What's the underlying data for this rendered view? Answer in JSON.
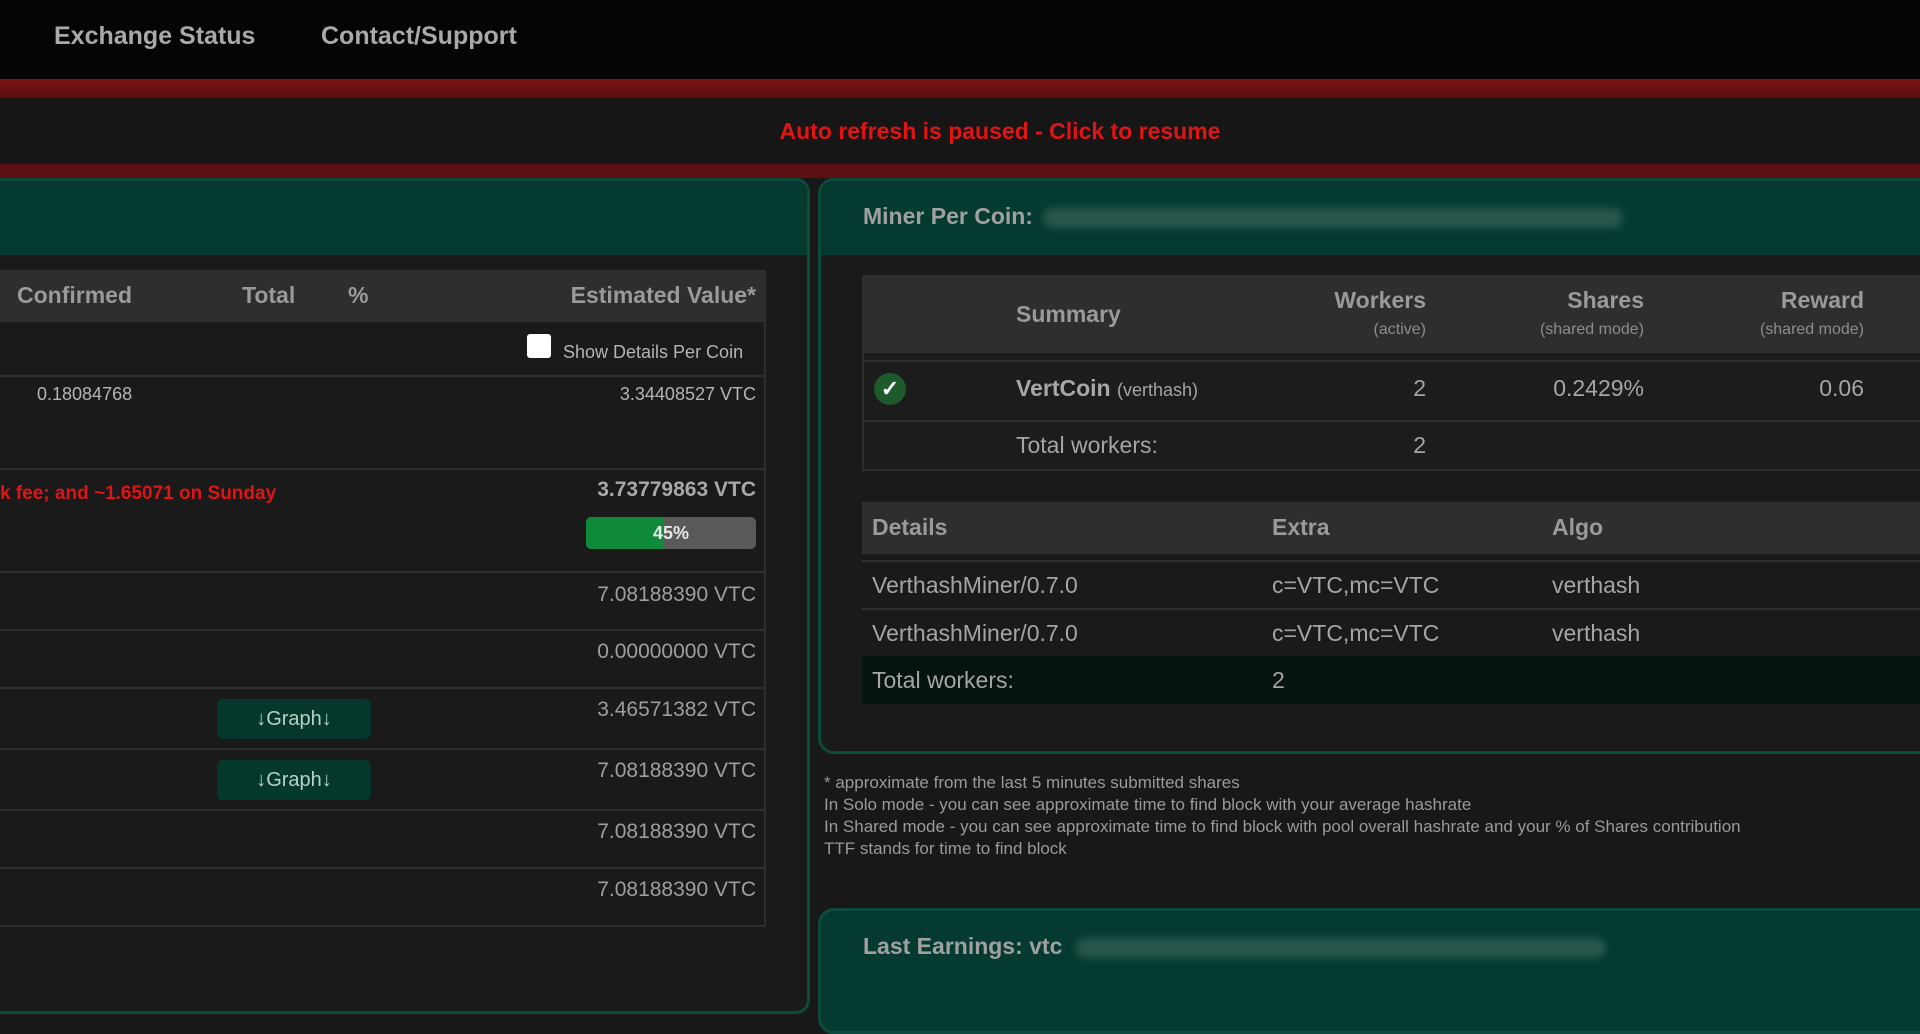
{
  "nav": {
    "items": [
      "Exchange Status",
      "Contact/Support"
    ]
  },
  "refresh": {
    "text": "Auto refresh is paused - Click to resume"
  },
  "balances": {
    "headers": {
      "confirmed": "Confirmed",
      "total": "Total",
      "percent": "%",
      "estimated": "Estimated Value*"
    },
    "show_details_label": "Show Details Per Coin",
    "coin_row": {
      "confirmed": "0.18084768",
      "estimated": "3.34408527 VTC"
    },
    "payout_fee_text": "k fee; and ~1.65071 on Sunday",
    "payout_value": "3.73779863 VTC",
    "progress": {
      "value": 45,
      "label": "45%"
    },
    "rows": [
      {
        "value": "7.08188390 VTC"
      },
      {
        "value": "0.00000000 VTC"
      },
      {
        "value": "3.46571382 VTC",
        "graph": "↓Graph↓"
      },
      {
        "value": "7.08188390 VTC",
        "graph": "↓Graph↓"
      },
      {
        "value": "7.08188390 VTC"
      },
      {
        "value": "7.08188390 VTC"
      }
    ]
  },
  "miner": {
    "title": "Miner Per Coin:",
    "summary": {
      "headers": {
        "summary": "Summary",
        "workers": "Workers",
        "workers_sub": "(active)",
        "shares": "Shares",
        "shares_sub": "(shared mode)",
        "reward": "Reward",
        "reward_sub": "(shared mode)"
      },
      "coin": {
        "name": "VertCoin",
        "algo": "(verthash)",
        "workers": "2",
        "shares": "0.2429%",
        "reward": "0.06"
      },
      "total": {
        "label": "Total workers:",
        "value": "2"
      }
    },
    "details": {
      "headers": {
        "details": "Details",
        "extra": "Extra",
        "algo": "Algo"
      },
      "rows": [
        {
          "details": "VerthashMiner/0.7.0",
          "extra": "c=VTC,mc=VTC",
          "algo": "verthash"
        },
        {
          "details": "VerthashMiner/0.7.0",
          "extra": "c=VTC,mc=VTC",
          "algo": "verthash"
        }
      ],
      "total": {
        "label": "Total workers:",
        "value": "2"
      }
    },
    "notes": [
      "* approximate from the last 5 minutes submitted shares",
      " In Solo mode - you can see approximate time to find block with your average hashrate",
      " In Shared mode - you can see approximate time to find block with pool overall hashrate and your % of Shares contribution",
      " TTF stands for time to find block"
    ]
  },
  "last_earnings": {
    "title": "Last Earnings: vtc"
  },
  "colors": {
    "accent": "#053a30",
    "alert": "#e01414",
    "progress": "#0e8a38"
  }
}
